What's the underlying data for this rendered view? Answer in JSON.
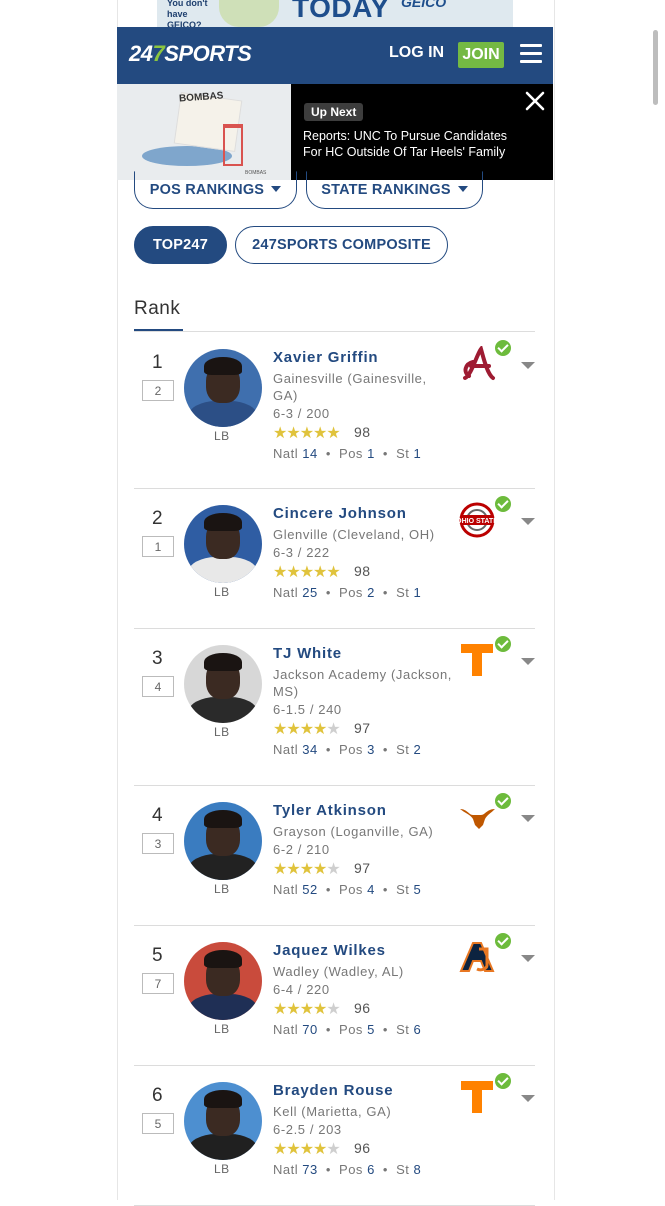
{
  "ad": {
    "small_text": "You don't have GEICO?",
    "headline": "TODAY",
    "brand": "GEICO"
  },
  "header": {
    "logo": "247SPORTS",
    "login": "LOG IN",
    "join": "JOIN"
  },
  "video": {
    "thumb_text": "BOMBAS",
    "thumb_tag": "BOMBAS",
    "up_next": "Up Next",
    "title": "Reports: UNC To Pursue Candidates For HC Outside Of Tar Heels' Family"
  },
  "filters": {
    "pos_rankings": "POS RANKINGS",
    "state_rankings": "STATE RANKINGS",
    "top247": "TOP247",
    "composite": "247SPORTS COMPOSITE"
  },
  "rank_header": "Rank",
  "players": [
    {
      "rank": "1",
      "prev": "2",
      "name": "Xavier Griffin",
      "school": "Gainesville (Gainesville, GA)",
      "ht_wt": "6-3 / 200",
      "stars": 5,
      "rating": "98",
      "natl": "14",
      "pos_rank": "1",
      "st": "1",
      "position": "LB",
      "team": "Alabama"
    },
    {
      "rank": "2",
      "prev": "1",
      "name": "Cincere Johnson",
      "school": "Glenville (Cleveland, OH)",
      "ht_wt": "6-3 / 222",
      "stars": 5,
      "rating": "98",
      "natl": "25",
      "pos_rank": "2",
      "st": "1",
      "position": "LB",
      "team": "Ohio State"
    },
    {
      "rank": "3",
      "prev": "4",
      "name": "TJ White",
      "school": "Jackson Academy (Jackson, MS)",
      "ht_wt": "6-1.5 / 240",
      "stars": 4,
      "rating": "97",
      "natl": "34",
      "pos_rank": "3",
      "st": "2",
      "position": "LB",
      "team": "Tennessee"
    },
    {
      "rank": "4",
      "prev": "3",
      "name": "Tyler Atkinson",
      "school": "Grayson (Loganville, GA)",
      "ht_wt": "6-2 / 210",
      "stars": 4,
      "rating": "97",
      "natl": "52",
      "pos_rank": "4",
      "st": "5",
      "position": "LB",
      "team": "Texas"
    },
    {
      "rank": "5",
      "prev": "7",
      "name": "Jaquez Wilkes",
      "school": "Wadley (Wadley, AL)",
      "ht_wt": "6-4 / 220",
      "stars": 4,
      "rating": "96",
      "natl": "70",
      "pos_rank": "5",
      "st": "6",
      "position": "LB",
      "team": "Auburn"
    },
    {
      "rank": "6",
      "prev": "5",
      "name": "Brayden Rouse",
      "school": "Kell (Marietta, GA)",
      "ht_wt": "6-2.5 / 203",
      "stars": 4,
      "rating": "96",
      "natl": "73",
      "pos_rank": "6",
      "st": "8",
      "position": "LB",
      "team": "Tennessee"
    }
  ],
  "labels": {
    "natl": "Natl",
    "pos": "Pos",
    "st": "St",
    "dot": "•"
  },
  "colors": {
    "brand_blue": "#234a80",
    "join_green": "#74b943",
    "star_gold": "#e0c33c",
    "commit_green": "#6dbb3c"
  }
}
